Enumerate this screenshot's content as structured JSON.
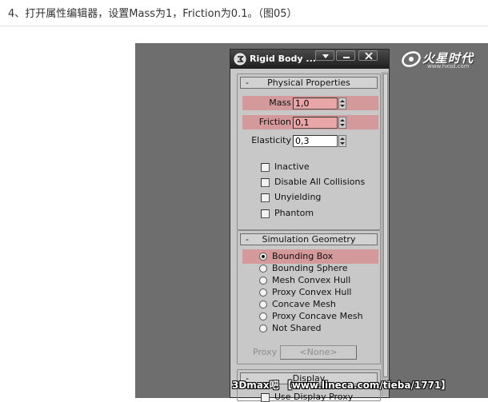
{
  "article": {
    "caption": "4、打开属性编辑器，设置Mass为1，Friction为0.1。（图05）"
  },
  "logo": {
    "text": "火星时代",
    "sub": "www.hxsd.com"
  },
  "window": {
    "title": "Rigid Body ..."
  },
  "physical_properties": {
    "header": "Physical Properties",
    "collapse_symbol": "-",
    "mass_label": "Mass",
    "mass_value": "1,0",
    "friction_label": "Friction",
    "friction_value": "0,1",
    "elasticity_label": "Elasticity",
    "elasticity_value": "0,3",
    "checkboxes": [
      {
        "label": "Inactive",
        "checked": false
      },
      {
        "label": "Disable All Collisions",
        "checked": false
      },
      {
        "label": "Unyielding",
        "checked": false
      },
      {
        "label": "Phantom",
        "checked": false
      }
    ]
  },
  "simulation_geometry": {
    "header": "Simulation Geometry",
    "collapse_symbol": "-",
    "options": [
      {
        "label": "Bounding Box",
        "selected": true
      },
      {
        "label": "Bounding Sphere",
        "selected": false
      },
      {
        "label": "Mesh Convex Hull",
        "selected": false
      },
      {
        "label": "Proxy Convex Hull",
        "selected": false
      },
      {
        "label": "Concave Mesh",
        "selected": false
      },
      {
        "label": "Proxy Concave Mesh",
        "selected": false
      },
      {
        "label": "Not Shared",
        "selected": false
      }
    ],
    "proxy_label": "Proxy",
    "proxy_button": "<None>"
  },
  "display": {
    "header": "Display",
    "collapse_symbol": "-",
    "checkbox_label": "Use Display Proxy"
  },
  "watermark": {
    "text": "3Dmax吧 【www.lineca.com/tieba/1771】"
  },
  "colors": {
    "highlight": "#d4999a",
    "panel": "#c8c8c8",
    "titlebar": "#1e1e1e",
    "stage": "#6e6e6e"
  }
}
